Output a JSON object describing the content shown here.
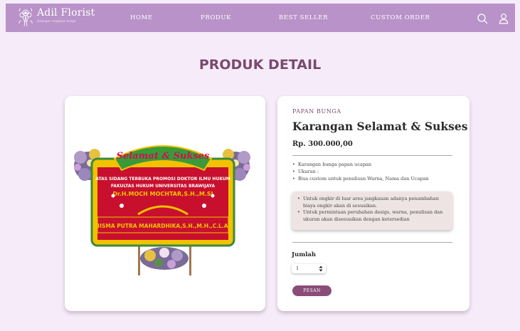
{
  "brand": {
    "name": "Adil Florist",
    "tagline": "Gelangan rangkaian bunga",
    "logo_icon": "flower-bouquet-icon"
  },
  "nav": {
    "items": [
      {
        "label": "HOME"
      },
      {
        "label": "PRODUK"
      },
      {
        "label": "BEST SELLER"
      },
      {
        "label": "CUSTOM ORDER"
      }
    ],
    "icons": [
      "search-icon",
      "user-icon"
    ]
  },
  "page": {
    "title": "PRODUK DETAIL"
  },
  "product": {
    "category": "PAPAN BUNGA",
    "name": "Karangan Selamat & Sukses",
    "price": "Rp. 300.000,00",
    "image_alt": "papan bunga selamat & sukses",
    "details": [
      "Karangan bunga papan ucapan",
      "Ukuran :",
      "Bisa custom untuk penulisan Warna, Nama dan Ucapan"
    ],
    "notes": [
      "Untuk ongkir di luar area jangkauan adanya penambahan biaya ongkir akan di sesuaikan.",
      "Untuk permintaan perubahan desigs, warna, penulisan dan ukuran akan disesuaikan dengan ketersedian"
    ],
    "board_text": {
      "banner": "Selamat & Sukses",
      "line1": "ATAS SIDANG TERBUKA PROMOSI DOKTOR ILMU HUKUM",
      "line2": "FAKULTAS HUKUM UNIVERSITAS BRAWIJAYA",
      "line3": "Dr.H.MOCH MOCHTAR,S.H.,M.SI",
      "sender": "BISMA PUTRA MAHARDHIKA,S.H.,M.H.,C.L.A."
    }
  },
  "order": {
    "quantity_label": "Jumlah",
    "quantity_value": "1",
    "button_label": "PESAN"
  },
  "colors": {
    "navbar": "#b892c8",
    "background": "#f6ecf9",
    "accent": "#7a4a6e",
    "button": "#8a4c78",
    "board_red": "#c8102e",
    "board_yellow": "#f2c200"
  }
}
